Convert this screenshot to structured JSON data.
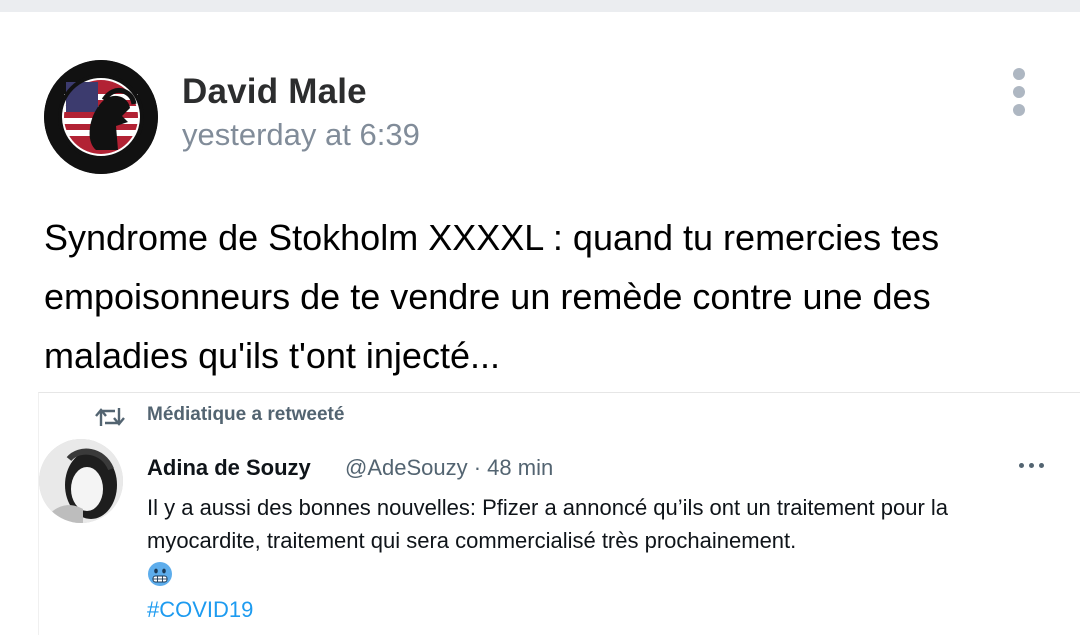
{
  "post": {
    "author": "David Male",
    "time": "yesterday at 6:39",
    "text": "Syndrome de Stokholm XXXXL : quand tu remercies tes empoisonneurs de te vendre un remède contre une des maladies qu'ils t'ont injecté..."
  },
  "embedded_tweet": {
    "retweet_label": "Médiatique a retweeté",
    "name": "Adina de Souzy",
    "handle_time": "@AdeSouzy · 48 min",
    "text": "Il y a aussi des bonnes nouvelles: Pfizer a annoncé qu’ils ont un traitement pour la myocardite, traitement qui sera commercialisé très prochainement.",
    "emoji": "grimacing-face-emoji",
    "hashtag": "#COVID19"
  },
  "icons": {
    "menu": "vertical-dots-icon",
    "retweet": "retweet-icon",
    "tweet_menu": "horizontal-dots-icon"
  },
  "colors": {
    "author": "#2c2d2e",
    "timestamp": "#818c99",
    "twitter_secondary": "#536471",
    "twitter_link": "#1d9bf0"
  }
}
